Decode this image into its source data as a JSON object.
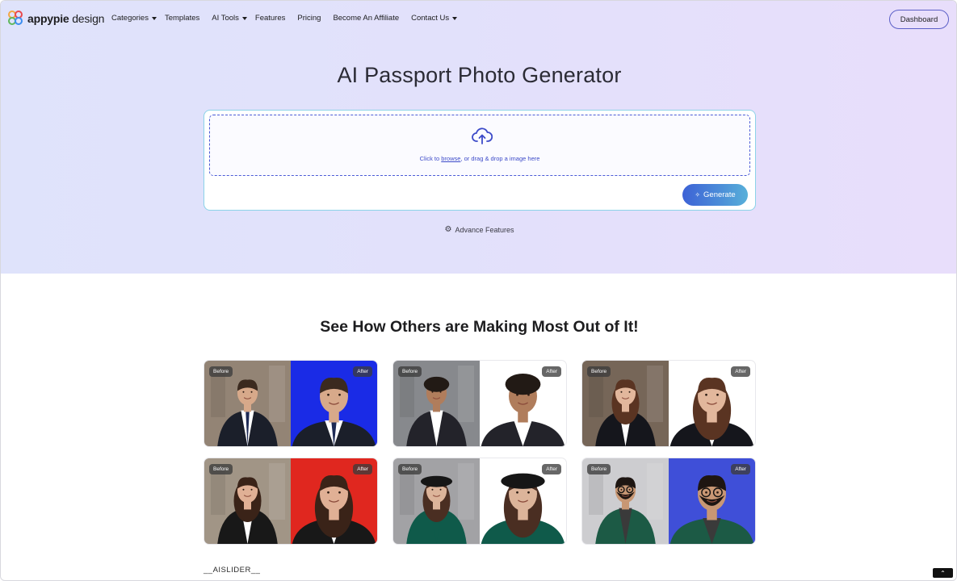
{
  "brand": {
    "name_bold": "appypie",
    "name_thin": " design"
  },
  "nav": {
    "items": [
      {
        "label": "Categories",
        "has_caret": true
      },
      {
        "label": "Templates",
        "has_caret": false
      },
      {
        "label": "AI Tools",
        "has_caret": true
      },
      {
        "label": "Features",
        "has_caret": false
      },
      {
        "label": "Pricing",
        "has_caret": false
      },
      {
        "label": "Become An Affiliate",
        "has_caret": false
      },
      {
        "label": "Contact Us",
        "has_caret": true
      }
    ],
    "dashboard_label": "Dashboard"
  },
  "hero": {
    "title": "AI Passport Photo Generator",
    "upload": {
      "text_before": "Click to ",
      "browse_label": "browse",
      "text_after": ", or drag & drop a image here",
      "icon": "cloud-upload-icon"
    },
    "generate_label": "Generate",
    "advance_label": "Advance Features"
  },
  "examples": {
    "title": "See How Others are Making Most Out of It!",
    "before_label": "Before",
    "after_label": "After",
    "cards": [
      {
        "subject": "man in suit",
        "before_bg": "#8a7a6a",
        "after_bg": "#1a2be6",
        "skin": "#d7a98a",
        "hair": "#3b2a1f",
        "suit": "#1b1f2a",
        "shirt": "#ffffff",
        "tie": "#1e2a55"
      },
      {
        "subject": "curly-haired man",
        "before_bg": "#7d7f84",
        "after_bg": "#ffffff",
        "skin": "#b07d5c",
        "hair": "#221a15",
        "suit": "#23232a",
        "shirt": "#ffffff",
        "tie": ""
      },
      {
        "subject": "woman with long hair",
        "before_bg": "#6b5a4a",
        "after_bg": "#ffffff",
        "skin": "#e2b79c",
        "hair": "#5a3422",
        "suit": "#15161c",
        "shirt": "#ffffff",
        "tie": ""
      },
      {
        "subject": "woman in office",
        "before_bg": "#9a8c7c",
        "after_bg": "#e0271f",
        "skin": "#e0b095",
        "hair": "#3a2318",
        "suit": "#181818",
        "shirt": "#ffffff",
        "tie": ""
      },
      {
        "subject": "woman with black hat",
        "before_bg": "#9b9b9e",
        "after_bg": "#ffffff",
        "skin": "#dcb49a",
        "hair": "#4a2e22",
        "suit": "#0f5a4a",
        "shirt": "#0f5a4a",
        "tie": "",
        "hat": "#161616"
      },
      {
        "subject": "bearded man with glasses",
        "before_bg": "#c9c9cc",
        "after_bg": "#3f4fd8",
        "skin": "#c89774",
        "hair": "#1e1612",
        "suit": "#1c5a45",
        "shirt": "#3a3a3a",
        "tie": "",
        "glasses": true
      }
    ]
  },
  "slider_token": "__AISLIDER__",
  "scroll_top_icon": "chevron-up-double-icon"
}
